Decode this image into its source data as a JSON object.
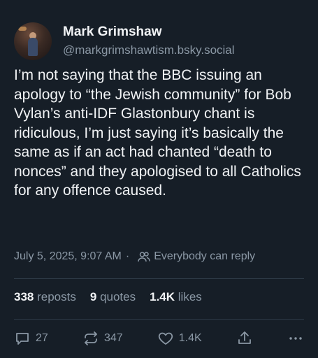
{
  "author": {
    "display_name": "Mark Grimshaw",
    "handle": "@markgrimshawtism.bsky.social",
    "avatar_icon": "avatar-photo"
  },
  "post": {
    "text": "I’m not saying that the BBC issuing an apology to “the Jewish community” for Bob Vylan’s anti-IDF Glastonbury chant is ridiculous, I’m just saying it’s basically the same as if an act had chanted “death to nonces” and they apologised to all Catholics for any offence caused.",
    "timestamp": "July 5, 2025, 9:07 AM",
    "reply_setting": "Everybody can reply",
    "reply_setting_icon": "people-icon"
  },
  "stats": {
    "reposts_value": "338",
    "reposts_label": "reposts",
    "quotes_value": "9",
    "quotes_label": "quotes",
    "likes_value": "1.4K",
    "likes_label": "likes"
  },
  "actions": {
    "reply_count": "27",
    "repost_count": "347",
    "like_count": "1.4K",
    "share_icon": "share-icon",
    "more_icon": "more-icon"
  },
  "colors": {
    "background": "#161e27",
    "text": "#f1f3f5",
    "muted": "#8b98a5",
    "divider": "#2e3a47"
  }
}
